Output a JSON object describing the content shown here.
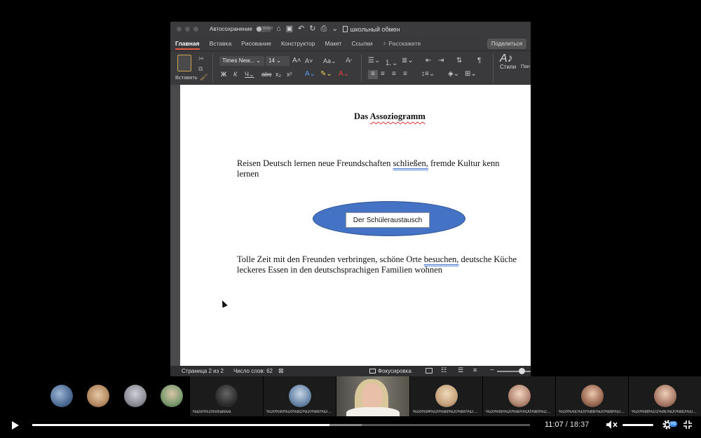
{
  "word": {
    "titlebar": {
      "autosave_label": "Автосохранение",
      "autosave_state": "ВЫКЛ",
      "document_name": "школьный обмен"
    },
    "tabs": [
      "Главная",
      "Вставка",
      "Рисование",
      "Конструктор",
      "Макет",
      "Ссылки"
    ],
    "tell_me": "Расскажите",
    "share_label": "Поделиться",
    "ribbon": {
      "paste_label": "Вставить",
      "font_name": "Times New...",
      "font_size": "14",
      "styles_label": "Стили",
      "styles_pane_label": "Пан стил"
    },
    "document": {
      "title_plain": "Das ",
      "title_underlined": "Assoziogramm",
      "para1": {
        "text_a": "Reisen   Deutsch lernen     neue Freundschaften ",
        "text_b": "schließen,",
        "text_c": "   fremde Kultur kenn",
        "text_d": "lernen"
      },
      "diagram_label": "Der Schüleraustausch",
      "para2": {
        "text_a": "Tolle Zeit mit den Freunden verbringen, schöne Orte ",
        "text_b": "besuchen,",
        "text_c": "  deutsche Küche",
        "text_d": "leckeres Essen   in den deutschsprachigen Familien wohnen"
      }
    },
    "statusbar": {
      "page": "Страница 2 из 2",
      "word_count": "Число слов: 62",
      "focus": "Фокусировка"
    }
  },
  "participants": {
    "tile_names": [
      "Nazim%20Ismailova",
      "%D0%90%D0%BD%D0%B0%D1%81...",
      "%D0%94%D0%B8%D0%B0%D0%BD...",
      "%D0%95%D0%BA%D0%B0%D1%82...",
      "%D0%AE%D0%BB%D0%B8%D1%8F...",
      "%D0%88%D1%8E%D0%BD%D0%BE..."
    ]
  },
  "player": {
    "current_time": "11:07",
    "separator": " / ",
    "duration": "18:37",
    "progress": 0.597,
    "hd_badge": "HD",
    "accent": "#3a8fe8"
  }
}
